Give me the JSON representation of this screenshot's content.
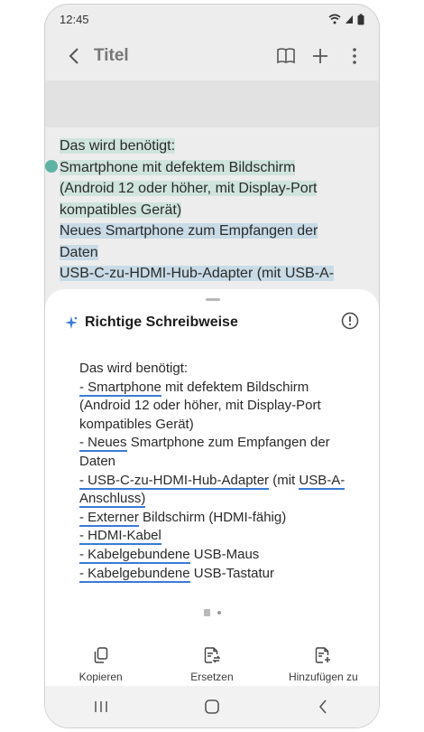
{
  "status": {
    "time": "12:45"
  },
  "appbar": {
    "title": "Titel"
  },
  "note": {
    "lines": [
      "Das wird benötigt:",
      "Smartphone mit defektem Bildschirm",
      "(Android 12 oder höher, mit Display-Port",
      "kompatibles Gerät)",
      "Neues Smartphone zum Empfangen der",
      "Daten",
      "USB-C-zu-HDMI-Hub-Adapter (mit USB-A-"
    ]
  },
  "sheet": {
    "title": "Richtige Schreibweise",
    "content": {
      "l1": "Das wird benötigt:",
      "l2_u": "- Smartphone",
      "l2_t": " mit defektem Bildschirm",
      "l3": "(Android 12 oder höher, mit Display-Port",
      "l4": "kompatibles Gerät)",
      "l5_u": "- Neues",
      "l5_t": " Smartphone zum Empfangen der",
      "l6": "Daten",
      "l7_u": "- USB-C-zu-HDMI-Hub-Adapter",
      "l7_t": " (mit ",
      "l7_u2": "USB-A-",
      "l8_u": "Anschluss)",
      "l9_u": "- Externer",
      "l9_t": " Bildschirm (HDMI-fähig)",
      "l10_u": "- HDMI-Kabel",
      "l11_u": "- Kabelgebundene",
      "l11_t": " USB-Maus",
      "l12_u": "- Kabelgebundene",
      "l12_t": " USB-Tastatur"
    },
    "actions": [
      {
        "label": "Kopieren",
        "icon": "copy-icon"
      },
      {
        "label": "Ersetzen",
        "icon": "replace-icon"
      },
      {
        "label": "Hinzufügen zu",
        "icon": "add-to-icon"
      }
    ]
  },
  "colors": {
    "accent_underline": "#3a7bd5",
    "highlight_green": "#cfe4dc",
    "highlight_blue": "#c8dbe6",
    "ai_star": "#3a7bd5"
  }
}
